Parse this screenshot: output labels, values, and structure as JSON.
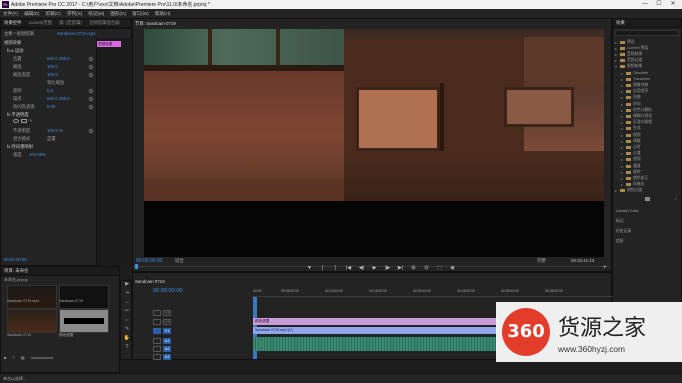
{
  "titlebar": {
    "app_icon": "Pr",
    "title": "Adobe Premiere Pro CC 2017 - C:\\用户\\xxx\\文档\\Adobe\\Premiere Pro\\11.0\\未命名.prproj *",
    "minimize": "—",
    "maximize": "☐",
    "close": "✕"
  },
  "menu": [
    "文件(F)",
    "编辑(E)",
    "剪辑(C)",
    "序列(S)",
    "标记(M)",
    "图形(G)",
    "窗口(W)",
    "帮助(H)"
  ],
  "effects": {
    "tabs": [
      "效果控件",
      "Lumetri范围",
      "源: (无剪辑)",
      "音频剪辑混合器"
    ],
    "source": "主要 * 视频剪辑",
    "clip_label": "Sandcam 0719 mp4",
    "clip_bar": "视频效果",
    "section_video": "视频效果",
    "fx_motion": "fx  ▸ 运动",
    "rows": [
      {
        "label": "位置",
        "value": "640.0  360.0"
      },
      {
        "label": "缩放",
        "value": "100.0"
      },
      {
        "label": "缩放宽度",
        "value": "100.0"
      },
      {
        "label": "",
        "value": "等比缩放"
      },
      {
        "label": "旋转",
        "value": "0.0"
      },
      {
        "label": "锚点",
        "value": "640.0  360.0"
      },
      {
        "label": "防闪烁滤镜",
        "value": "0.00"
      },
      {
        "label": "fx  不透明度",
        "value": ""
      },
      {
        "label": "不透明度",
        "value": "100.0 %"
      },
      {
        "label": "混合模式",
        "value": "正常"
      },
      {
        "label": "fx  时间重映射",
        "value": ""
      },
      {
        "label": "速度",
        "value": "100.00%"
      }
    ],
    "timecode": "00:00:00:00"
  },
  "program": {
    "tab": "节目: Sandcam 0719",
    "timecode_left": "00:00:00:00",
    "zoom": "适合",
    "quality": "完整",
    "timecode_right": "00:33:41:23",
    "transport": [
      "▼",
      "{",
      "}",
      "|◀",
      "◀|",
      "▶",
      "|▶",
      "▶|",
      "⊞",
      "⊟",
      "⬚",
      "◉"
    ],
    "add": "+"
  },
  "rightpanel": {
    "header": "效果",
    "items": [
      {
        "label": "预设",
        "fold": true
      },
      {
        "label": "Lumetri 预设",
        "fold": true
      },
      {
        "label": "音频效果",
        "fold": true
      },
      {
        "label": "音频过渡",
        "fold": true
      },
      {
        "label": "视频效果",
        "fold": true,
        "open": true
      },
      {
        "label": "Obsolete",
        "fold": true
      },
      {
        "label": "Transform",
        "fold": true
      },
      {
        "label": "图像控制",
        "fold": true
      },
      {
        "label": "实用程序",
        "fold": true
      },
      {
        "label": "扭曲",
        "fold": true
      },
      {
        "label": "时间",
        "fold": true
      },
      {
        "label": "杂色与颗粒",
        "fold": true
      },
      {
        "label": "模糊与锐化",
        "fold": true
      },
      {
        "label": "沉浸式视频",
        "fold": true
      },
      {
        "label": "生成",
        "fold": true
      },
      {
        "label": "视频",
        "fold": true
      },
      {
        "label": "调整",
        "fold": true
      },
      {
        "label": "过时",
        "fold": true
      },
      {
        "label": "过渡",
        "fold": true
      },
      {
        "label": "透视",
        "fold": true
      },
      {
        "label": "通道",
        "fold": true
      },
      {
        "label": "键控",
        "fold": true
      },
      {
        "label": "颜色校正",
        "fold": true
      },
      {
        "label": "风格化",
        "fold": true
      },
      {
        "label": "视频过渡",
        "fold": true
      }
    ],
    "sections": [
      "Lumetri Color",
      "标记",
      "历史记录",
      "信息"
    ]
  },
  "project": {
    "tabs": [
      "项目: 未命名"
    ],
    "file": "未命名.prproj",
    "items": [
      {
        "name": "Sandcam 0719.mp4",
        "duration": "33:41:23"
      },
      {
        "name": "Sandcam 0719",
        "duration": "33:41:23"
      },
      {
        "name": "Sandcam 0719",
        "duration": "33:41:23"
      },
      {
        "name": "颜色遮罩",
        "duration": "5:00"
      }
    ]
  },
  "tools": [
    "▶",
    "⇥",
    "↔",
    "✂",
    "⇔",
    "✎",
    "✋",
    "T"
  ],
  "timeline": {
    "tab": "Sandcam 0719",
    "timecode": "00:00:00:00",
    "ruler": [
      "00:00",
      "00:05:00:00",
      "00:10:00:00",
      "00:15:00:00",
      "00:20:00:00",
      "00:25:00:00",
      "00:30:00:00",
      "00:35:00:00"
    ],
    "video_tracks": [
      "V3",
      "V2",
      "V1"
    ],
    "audio_tracks": [
      "A1",
      "A2",
      "A3"
    ],
    "clip_v2": "颜色遮罩",
    "clip_v1": "Sandcam 0719.mp4 [V]",
    "clip_a1": "",
    "master": "主声道",
    "master_value": "0.0"
  },
  "status": "单击以选择...",
  "watermark": {
    "logo": "360",
    "text": "货源之家",
    "url": "www.360hyzj.com"
  },
  "colors": {
    "accent": "#3e8ee6",
    "clip_pink": "#d66ce0",
    "clip_blue": "#8fa6e8",
    "clip_audio": "#3a8a72"
  }
}
